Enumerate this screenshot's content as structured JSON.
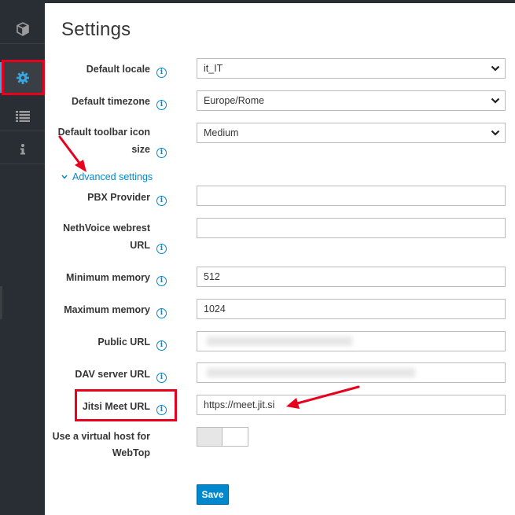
{
  "page": {
    "title": "Settings"
  },
  "sidebar": {
    "items": [
      {
        "icon": "cube-icon"
      },
      {
        "icon": "gear-icon",
        "active": true
      },
      {
        "icon": "list-icon"
      },
      {
        "icon": "info-icon"
      }
    ]
  },
  "form": {
    "default_locale": {
      "label": "Default locale",
      "value": "it_IT"
    },
    "default_timezone": {
      "label": "Default timezone",
      "value": "Europe/Rome"
    },
    "toolbar_icon_size": {
      "label_line1": "Default toolbar icon",
      "label_line2": "size",
      "value": "Medium"
    },
    "advanced_toggle": {
      "label": "Advanced settings"
    },
    "pbx_provider": {
      "label": "PBX Provider",
      "value": ""
    },
    "nethvoice_webrest": {
      "label_line1": "NethVoice webrest",
      "label_line2": "URL",
      "value": ""
    },
    "minimum_memory": {
      "label": "Minimum memory",
      "value": "512"
    },
    "maximum_memory": {
      "label": "Maximum memory",
      "value": "1024"
    },
    "public_url": {
      "label": "Public URL"
    },
    "dav_server_url": {
      "label": "DAV server URL"
    },
    "jitsi_meet_url": {
      "label": "Jitsi Meet URL",
      "value": "https://meet.jit.si"
    },
    "virtual_host": {
      "label_line1": "Use a virtual host for",
      "label_line2": "WebTop"
    },
    "save_label": "Save"
  },
  "colors": {
    "accent": "#0088ce",
    "sidebar_bg": "#292e34",
    "annotation_red": "#e8001d"
  }
}
